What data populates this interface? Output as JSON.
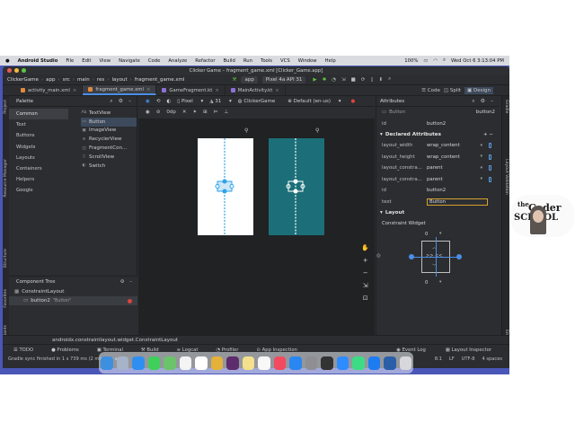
{
  "mac_menubar": {
    "app": "Android Studio",
    "menus": [
      "File",
      "Edit",
      "View",
      "Navigate",
      "Code",
      "Analyze",
      "Refactor",
      "Build",
      "Run",
      "Tools",
      "VCS",
      "Window",
      "Help"
    ],
    "battery": "100%",
    "clock": "Wed Oct 6  3:13:04 PM"
  },
  "window": {
    "title": "Clicker Game – fragment_game.xml [Clicker_Game.app]"
  },
  "navbar": {
    "breadcrumbs": [
      "ClickerGame",
      "app",
      "src",
      "main",
      "res",
      "layout",
      "fragment_game.xml"
    ],
    "run_config": "app",
    "device": "Pixel 4a API 31"
  },
  "tabs": [
    {
      "label": "activity_main.xml",
      "color": "#e08a3c",
      "active": false
    },
    {
      "label": "fragment_game.xml",
      "color": "#e08a3c",
      "active": true
    },
    {
      "label": "GameFragment.kt",
      "color": "#8f6fd8",
      "active": false
    },
    {
      "label": "MainActivity.kt",
      "color": "#8f6fd8",
      "active": false
    }
  ],
  "left_strip": [
    "Project",
    "Resource Manager",
    "Structure",
    "Favorites",
    "Build Variants"
  ],
  "right_strip": [
    "Gradle",
    "Layout Validation",
    "Emulator"
  ],
  "view_modes": {
    "code": "Code",
    "split": "Split",
    "design": "Design"
  },
  "palette": {
    "title": "Palette",
    "categories": [
      "Common",
      "Text",
      "Buttons",
      "Widgets",
      "Layouts",
      "Containers",
      "Helpers",
      "Google"
    ],
    "items": [
      {
        "glyph": "Ab",
        "label": "TextView"
      },
      {
        "glyph": "▭",
        "label": "Button"
      },
      {
        "glyph": "▣",
        "label": "ImageView"
      },
      {
        "glyph": "≡",
        "label": "RecyclerView"
      },
      {
        "glyph": "◫",
        "label": "FragmentCon..."
      },
      {
        "glyph": "▯",
        "label": "ScrollView"
      },
      {
        "glyph": "◐",
        "label": "Switch"
      }
    ]
  },
  "component_tree": {
    "title": "Component Tree",
    "root": "ConstraintLayout",
    "child_id": "button2",
    "child_text": "\"Button\""
  },
  "design_toolbar": {
    "device": "Pixel",
    "api": "31",
    "theme": "ClickerGame",
    "locale": "Default (en-us)",
    "margin": "0dp"
  },
  "attributes": {
    "title": "Attributes",
    "selected_type": "Button",
    "selected_id": "button2",
    "id_label": "id",
    "id_value": "button2",
    "declared_title": "Declared Attributes",
    "declared": [
      {
        "key": "layout_width",
        "value": "wrap_content"
      },
      {
        "key": "layout_height",
        "value": "wrap_content"
      },
      {
        "key": "layout_constra...",
        "value": "parent"
      },
      {
        "key": "layout_constra...",
        "value": "parent"
      },
      {
        "key": "id",
        "value": "button2"
      },
      {
        "key": "text",
        "value": "Button"
      }
    ],
    "layout_title": "Layout",
    "constraint_title": "Constraint Widget",
    "margin_top": "0",
    "margin_bottom": "0"
  },
  "status": {
    "crumb": "androidx.constraintlayout.widget.ConstraintLayout",
    "tools": [
      "TODO",
      "Problems",
      "Terminal",
      "Build",
      "Logcat",
      "Profiler",
      "App Inspection"
    ],
    "event_log": "Event Log",
    "layout_inspector": "Layout Inspector",
    "gradle_msg": "Gradle sync finished in 1 s 739 ms (2 minutes ago)",
    "position": "8:1",
    "line_ending": "LF",
    "encoding": "UTF-8",
    "indent": "4 spaces"
  },
  "webcam_logo": {
    "line1": "the",
    "line2": "Coder",
    "line3": "SCHOOL"
  },
  "colors": {
    "accent": "#4b8ee6",
    "blueprint": "#1c6f78",
    "constraint": "#2aa3e8",
    "ide_bg": "#2b2d30",
    "desktop": "#4a56b8"
  },
  "dock_icons": [
    "finder-icon",
    "launchpad-icon",
    "safari-icon",
    "messages-icon",
    "maps-icon",
    "photos-icon",
    "calendar-icon",
    "chrome-icon",
    "slack-icon",
    "notes-icon",
    "reminders-icon",
    "music-icon",
    "appstore-icon",
    "settings-icon",
    "terminal-icon",
    "zoom-icon",
    "android-studio-icon",
    "xcode-icon",
    "sourcetree-icon",
    "trash-icon"
  ]
}
